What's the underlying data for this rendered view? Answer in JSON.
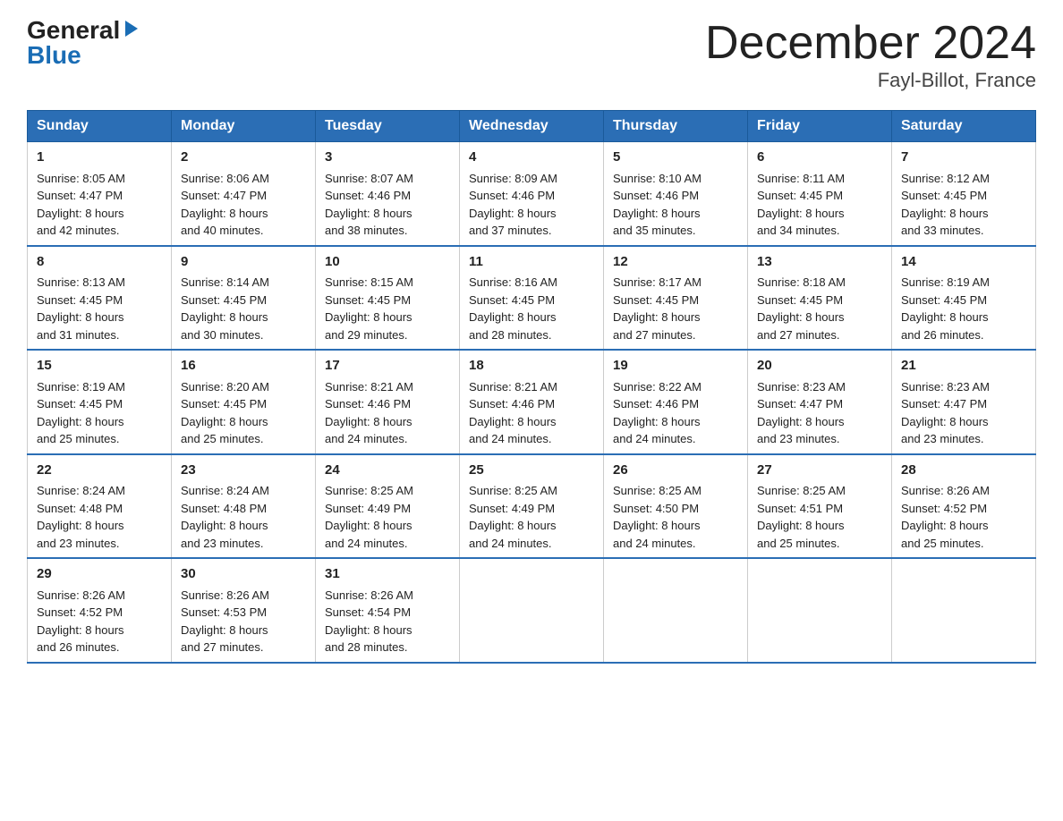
{
  "header": {
    "logo_general": "General",
    "logo_blue": "Blue",
    "month_year": "December 2024",
    "location": "Fayl-Billot, France"
  },
  "days_of_week": [
    "Sunday",
    "Monday",
    "Tuesday",
    "Wednesday",
    "Thursday",
    "Friday",
    "Saturday"
  ],
  "weeks": [
    [
      {
        "day": "1",
        "sunrise": "8:05 AM",
        "sunset": "4:47 PM",
        "daylight": "8 hours and 42 minutes."
      },
      {
        "day": "2",
        "sunrise": "8:06 AM",
        "sunset": "4:47 PM",
        "daylight": "8 hours and 40 minutes."
      },
      {
        "day": "3",
        "sunrise": "8:07 AM",
        "sunset": "4:46 PM",
        "daylight": "8 hours and 38 minutes."
      },
      {
        "day": "4",
        "sunrise": "8:09 AM",
        "sunset": "4:46 PM",
        "daylight": "8 hours and 37 minutes."
      },
      {
        "day": "5",
        "sunrise": "8:10 AM",
        "sunset": "4:46 PM",
        "daylight": "8 hours and 35 minutes."
      },
      {
        "day": "6",
        "sunrise": "8:11 AM",
        "sunset": "4:45 PM",
        "daylight": "8 hours and 34 minutes."
      },
      {
        "day": "7",
        "sunrise": "8:12 AM",
        "sunset": "4:45 PM",
        "daylight": "8 hours and 33 minutes."
      }
    ],
    [
      {
        "day": "8",
        "sunrise": "8:13 AM",
        "sunset": "4:45 PM",
        "daylight": "8 hours and 31 minutes."
      },
      {
        "day": "9",
        "sunrise": "8:14 AM",
        "sunset": "4:45 PM",
        "daylight": "8 hours and 30 minutes."
      },
      {
        "day": "10",
        "sunrise": "8:15 AM",
        "sunset": "4:45 PM",
        "daylight": "8 hours and 29 minutes."
      },
      {
        "day": "11",
        "sunrise": "8:16 AM",
        "sunset": "4:45 PM",
        "daylight": "8 hours and 28 minutes."
      },
      {
        "day": "12",
        "sunrise": "8:17 AM",
        "sunset": "4:45 PM",
        "daylight": "8 hours and 27 minutes."
      },
      {
        "day": "13",
        "sunrise": "8:18 AM",
        "sunset": "4:45 PM",
        "daylight": "8 hours and 27 minutes."
      },
      {
        "day": "14",
        "sunrise": "8:19 AM",
        "sunset": "4:45 PM",
        "daylight": "8 hours and 26 minutes."
      }
    ],
    [
      {
        "day": "15",
        "sunrise": "8:19 AM",
        "sunset": "4:45 PM",
        "daylight": "8 hours and 25 minutes."
      },
      {
        "day": "16",
        "sunrise": "8:20 AM",
        "sunset": "4:45 PM",
        "daylight": "8 hours and 25 minutes."
      },
      {
        "day": "17",
        "sunrise": "8:21 AM",
        "sunset": "4:46 PM",
        "daylight": "8 hours and 24 minutes."
      },
      {
        "day": "18",
        "sunrise": "8:21 AM",
        "sunset": "4:46 PM",
        "daylight": "8 hours and 24 minutes."
      },
      {
        "day": "19",
        "sunrise": "8:22 AM",
        "sunset": "4:46 PM",
        "daylight": "8 hours and 24 minutes."
      },
      {
        "day": "20",
        "sunrise": "8:23 AM",
        "sunset": "4:47 PM",
        "daylight": "8 hours and 23 minutes."
      },
      {
        "day": "21",
        "sunrise": "8:23 AM",
        "sunset": "4:47 PM",
        "daylight": "8 hours and 23 minutes."
      }
    ],
    [
      {
        "day": "22",
        "sunrise": "8:24 AM",
        "sunset": "4:48 PM",
        "daylight": "8 hours and 23 minutes."
      },
      {
        "day": "23",
        "sunrise": "8:24 AM",
        "sunset": "4:48 PM",
        "daylight": "8 hours and 23 minutes."
      },
      {
        "day": "24",
        "sunrise": "8:25 AM",
        "sunset": "4:49 PM",
        "daylight": "8 hours and 24 minutes."
      },
      {
        "day": "25",
        "sunrise": "8:25 AM",
        "sunset": "4:49 PM",
        "daylight": "8 hours and 24 minutes."
      },
      {
        "day": "26",
        "sunrise": "8:25 AM",
        "sunset": "4:50 PM",
        "daylight": "8 hours and 24 minutes."
      },
      {
        "day": "27",
        "sunrise": "8:25 AM",
        "sunset": "4:51 PM",
        "daylight": "8 hours and 25 minutes."
      },
      {
        "day": "28",
        "sunrise": "8:26 AM",
        "sunset": "4:52 PM",
        "daylight": "8 hours and 25 minutes."
      }
    ],
    [
      {
        "day": "29",
        "sunrise": "8:26 AM",
        "sunset": "4:52 PM",
        "daylight": "8 hours and 26 minutes."
      },
      {
        "day": "30",
        "sunrise": "8:26 AM",
        "sunset": "4:53 PM",
        "daylight": "8 hours and 27 minutes."
      },
      {
        "day": "31",
        "sunrise": "8:26 AM",
        "sunset": "4:54 PM",
        "daylight": "8 hours and 28 minutes."
      },
      null,
      null,
      null,
      null
    ]
  ]
}
